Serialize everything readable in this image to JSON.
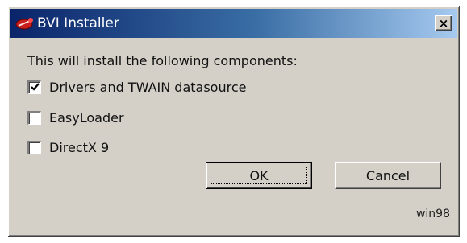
{
  "window": {
    "title": "BVI Installer",
    "close_label": "×"
  },
  "dialog": {
    "heading": "This will install the following components:",
    "options": [
      {
        "label": "Drivers and TWAIN datasource",
        "checked": true
      },
      {
        "label": "EasyLoader",
        "checked": false
      },
      {
        "label": "DirectX 9",
        "checked": false
      }
    ],
    "ok_label": "OK",
    "cancel_label": "Cancel",
    "os_label": "win98"
  },
  "colors": {
    "title_bar_start": "#0a246a",
    "title_bar_end": "#a6caf0",
    "face": "#d4d0c8"
  },
  "icons": {
    "app": "bvi-app-icon",
    "close": "close-icon",
    "check": "check-icon"
  }
}
